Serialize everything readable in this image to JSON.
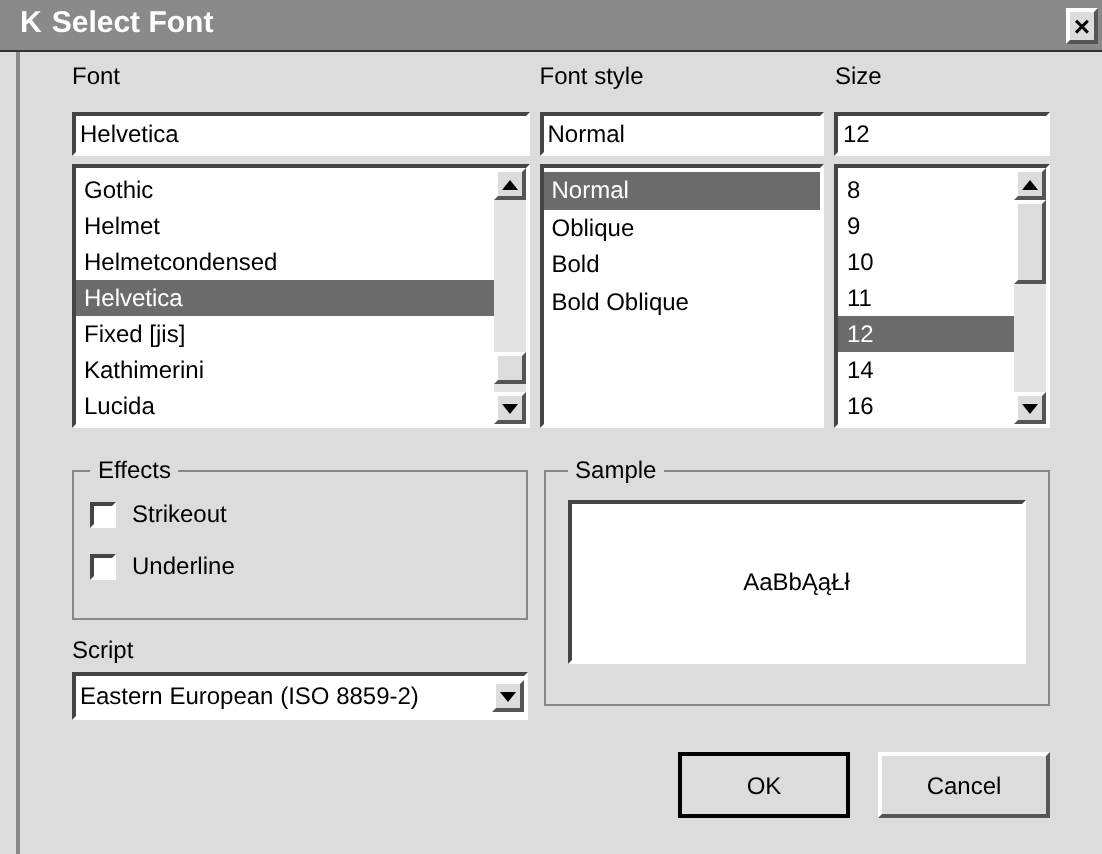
{
  "window": {
    "title": "Select Font",
    "logo": "K",
    "close": "×"
  },
  "font": {
    "label": "Font",
    "value": "Helvetica",
    "items": [
      {
        "name": "Gothic",
        "selected": false
      },
      {
        "name": "Helmet",
        "selected": false
      },
      {
        "name": "Helmetcondensed",
        "selected": false
      },
      {
        "name": "Helvetica",
        "selected": true
      },
      {
        "name": "Fixed [jis]",
        "selected": false
      },
      {
        "name": "Kathimerini",
        "selected": false
      },
      {
        "name": "Lucida",
        "selected": false
      }
    ]
  },
  "style": {
    "label": "Font style",
    "value": "Normal",
    "items": [
      {
        "name": "Normal",
        "selected": true
      },
      {
        "name": "Oblique",
        "selected": false
      },
      {
        "name": "Bold",
        "selected": false
      },
      {
        "name": "Bold Oblique",
        "selected": false
      }
    ]
  },
  "size": {
    "label": "Size",
    "value": "12",
    "items": [
      {
        "name": "8",
        "selected": false
      },
      {
        "name": "9",
        "selected": false
      },
      {
        "name": "10",
        "selected": false
      },
      {
        "name": "11",
        "selected": false
      },
      {
        "name": "12",
        "selected": true
      },
      {
        "name": "14",
        "selected": false
      },
      {
        "name": "16",
        "selected": false
      }
    ]
  },
  "effects": {
    "title": "Effects",
    "options": [
      {
        "label": "Strikeout",
        "checked": false
      },
      {
        "label": "Underline",
        "checked": false
      }
    ]
  },
  "script": {
    "label": "Script",
    "value": "Eastern European (ISO 8859-2)"
  },
  "sample": {
    "title": "Sample",
    "text": "AaBbĄąŁł"
  },
  "buttons": [
    "OK",
    "Cancel"
  ]
}
